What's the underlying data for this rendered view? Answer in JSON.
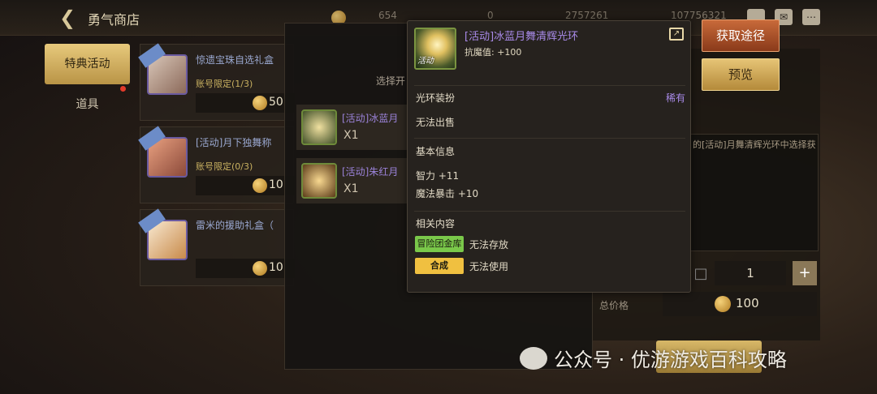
{
  "topbar": {
    "back_icon": "back-arrow-icon",
    "title": "勇气商店",
    "resource_1": "654",
    "resource_2": "0",
    "resource_3": "2757261",
    "resource_4": "107756321"
  },
  "tabs": [
    {
      "label": "特典活动",
      "active": true
    },
    {
      "label": "道具",
      "active": false
    }
  ],
  "items": [
    {
      "name": "惊遗宝珠自选礼盒",
      "limit": "账号限定(1/3)",
      "price": "50"
    },
    {
      "name": "[活动]月下独舞称",
      "limit": "账号限定(0/3)",
      "price": "10"
    },
    {
      "name": "雷米的援助礼盒（",
      "limit": "",
      "price": "10"
    }
  ],
  "select_panel": {
    "header": "选择开",
    "options": [
      {
        "name": "[活动]冰蓝月",
        "qty": "X1"
      },
      {
        "name": "[活动]朱红月",
        "qty": "X1"
      }
    ]
  },
  "right_panel": {
    "desc": "的[活动]月舞清辉光环中选择获",
    "quantity": "1",
    "total_label": "总价格",
    "total": "100"
  },
  "buttons": {
    "obtain": "获取途径",
    "preview": "预览"
  },
  "tooltip": {
    "icon_tag": "活动",
    "title": "[活动]冰蓝月舞清辉光环",
    "stat": "抗魔值: +100",
    "section_aura": "光环装扮",
    "rarity": "稀有",
    "no_sell": "无法出售",
    "section_basic": "基本信息",
    "basic_stats": [
      "智力 +11",
      "魔法暴击 +10"
    ],
    "section_related": "相关内容",
    "related": [
      {
        "badge": "冒险团金库",
        "text": "无法存放",
        "color": "#7ac84a"
      },
      {
        "badge": "合成",
        "text": "无法使用",
        "color": "#f0c040"
      }
    ]
  },
  "watermark": "公众号 · 优游游戏百科攻略"
}
